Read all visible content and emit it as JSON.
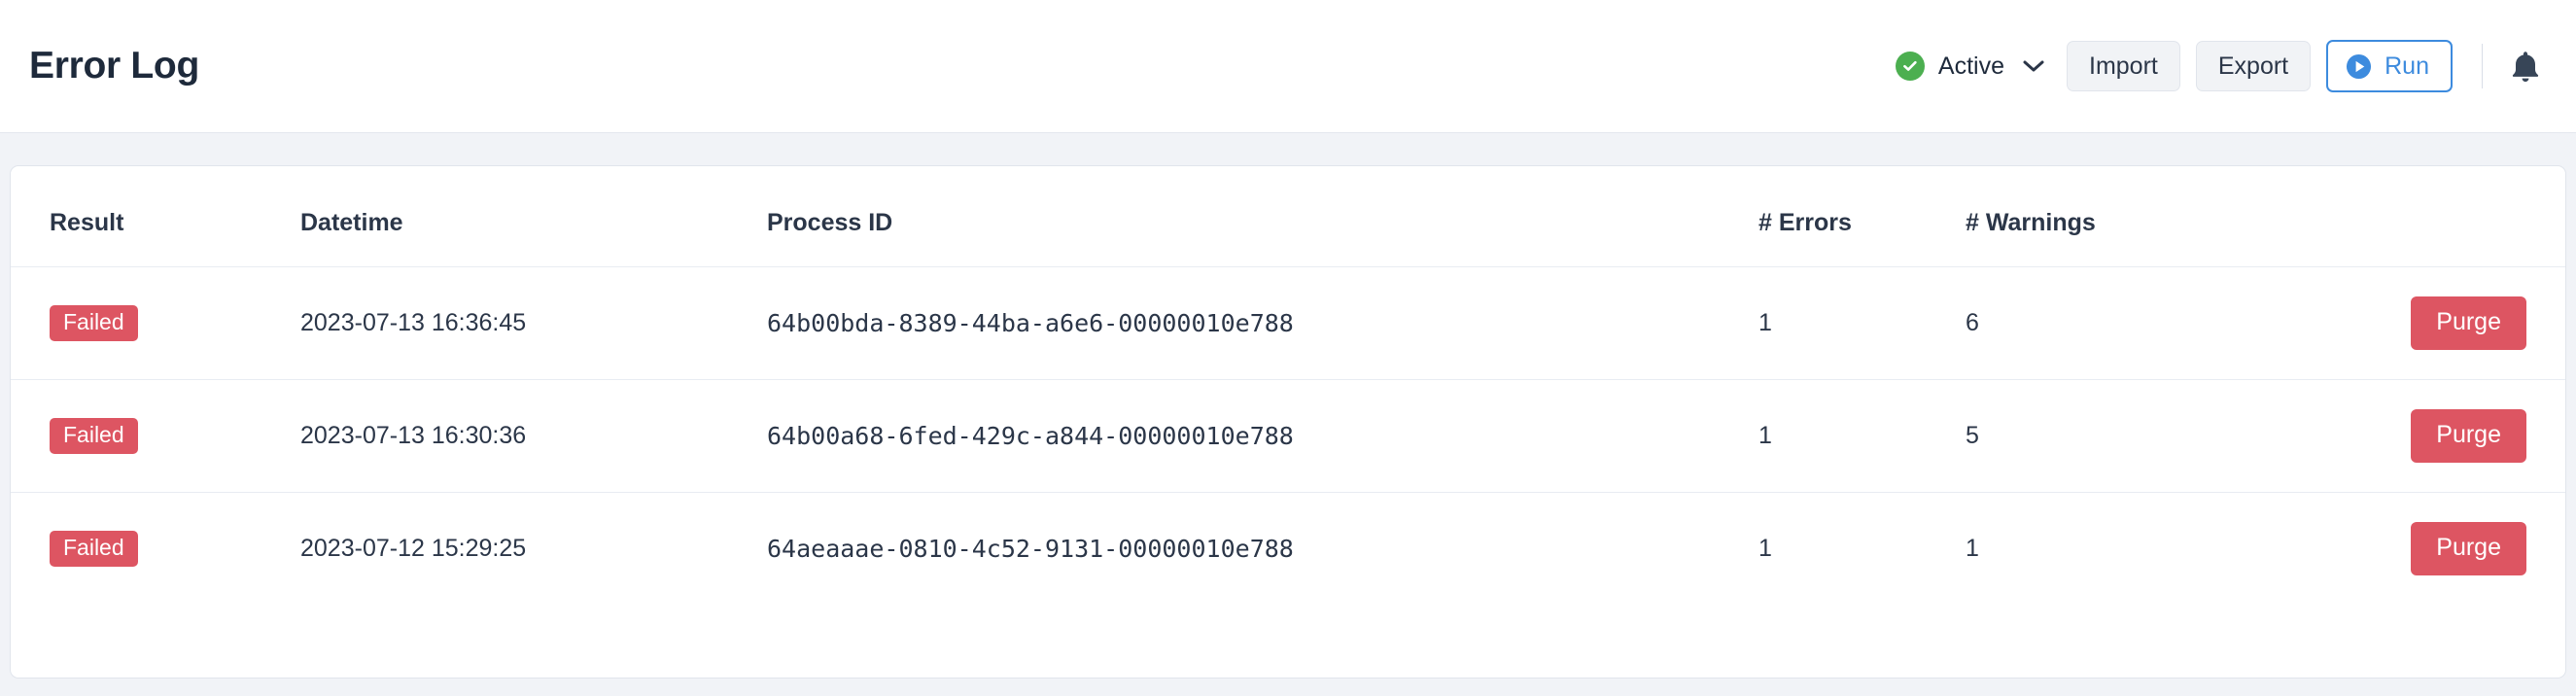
{
  "header": {
    "title": "Error Log",
    "status": {
      "icon": "check-circle-icon",
      "label": "Active",
      "chevron": "chevron-down-icon",
      "color": "#4caf50"
    },
    "buttons": {
      "import": "Import",
      "export": "Export",
      "run": "Run",
      "run_icon": "play-circle-icon",
      "run_color": "#3d8bde"
    },
    "notifications_icon": "bell-icon"
  },
  "table": {
    "columns": [
      "Result",
      "Datetime",
      "Process ID",
      "# Errors",
      "# Warnings",
      ""
    ],
    "action_label": "Purge",
    "badge_color": "#dd5562",
    "rows": [
      {
        "result": "Failed",
        "datetime": "2023-07-13 16:36:45",
        "process_id": "64b00bda-8389-44ba-a6e6-00000010e788",
        "errors": "1",
        "warnings": "6",
        "action": "Purge"
      },
      {
        "result": "Failed",
        "datetime": "2023-07-13 16:30:36",
        "process_id": "64b00a68-6fed-429c-a844-00000010e788",
        "errors": "1",
        "warnings": "5",
        "action": "Purge"
      },
      {
        "result": "Failed",
        "datetime": "2023-07-12 15:29:25",
        "process_id": "64aeaaae-0810-4c52-9131-00000010e788",
        "errors": "1",
        "warnings": "1",
        "action": "Purge"
      }
    ]
  }
}
